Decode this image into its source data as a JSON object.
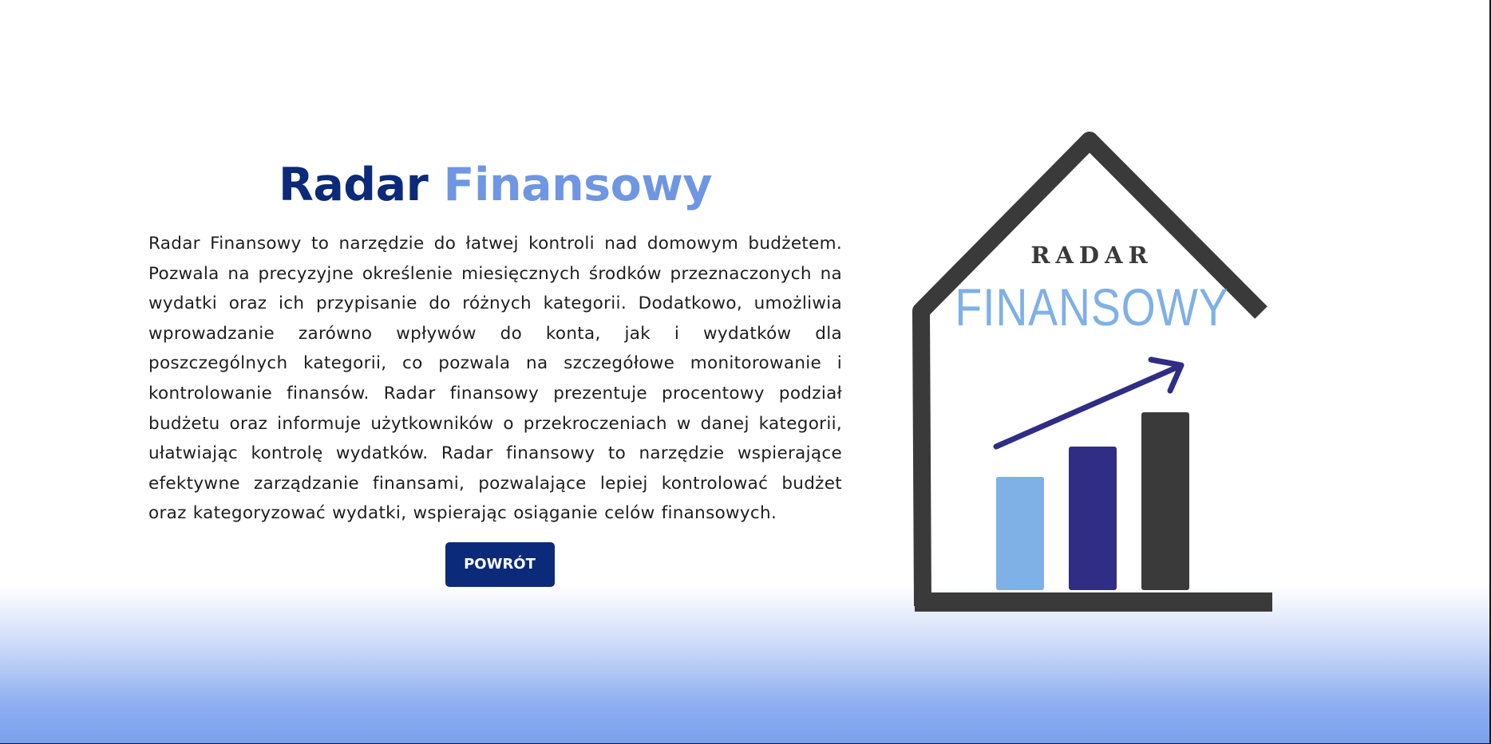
{
  "page": {
    "title_part1": "Radar",
    "title_part2": "Finansowy",
    "description": "Radar Finansowy to narzędzie do łatwej kontroli nad domowym budżetem. Pozwala na precyzyjne określenie miesięcznych środków przeznaczonych na wydatki oraz ich przypisanie do różnych kategorii. Dodatkowo, umożliwia wprowadzanie zarówno wpływów do konta, jak i wydatków dla poszczególnych kategorii, co pozwala na szczegółowe monitorowanie i kontrolowanie finansów. Radar finansowy prezentuje procentowy podział budżetu oraz informuje użytkowników o przekroczeniach w danej kategorii, ułatwiając kontrolę wydatków. Radar finansowy to narzędzie wspierające efektywne zarządzanie finansami, pozwalające lepiej kontrolować budżet oraz kategoryzować wydatki, wspierając osiąganie celów finansowych.",
    "back_button_label": "POWRÓT"
  },
  "logo": {
    "line1": "RADAR",
    "line2": "FINANSOWY",
    "icon": "house-bar-chart-logo"
  },
  "colors": {
    "title_dark": "#0b2a7a",
    "title_light": "#6e96e3",
    "button_bg": "#0b2a7a",
    "logo_gray": "#3a3a3a",
    "logo_light_blue": "#7fb0e6",
    "logo_navy": "#302d85",
    "gradient_bottom": "#7aa0ee"
  }
}
